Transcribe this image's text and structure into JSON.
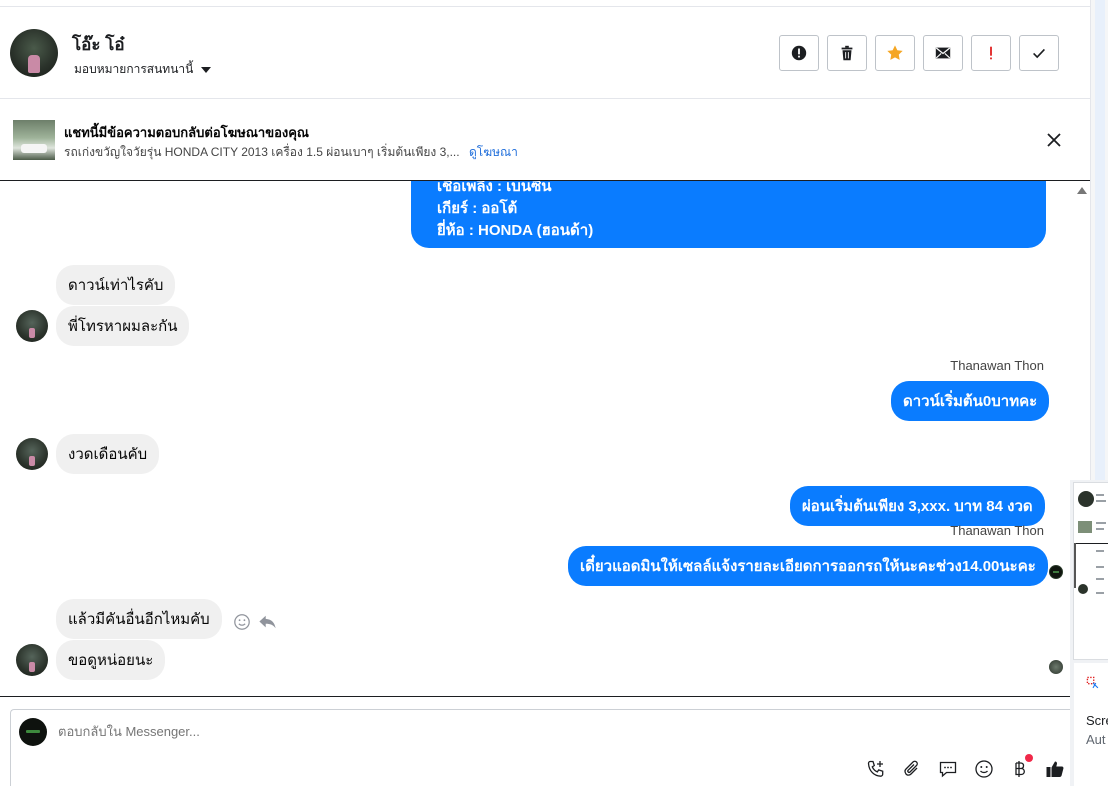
{
  "header": {
    "contact_name": "โอ๊ะ โอ๋",
    "assign_label": "มอบหมายการสนทนานี้",
    "buttons": [
      {
        "name": "mark-spam-button",
        "icon": "exclamation-circle-icon"
      },
      {
        "name": "delete-button",
        "icon": "trash-icon"
      },
      {
        "name": "star-button",
        "icon": "star-icon",
        "color": "#f5a623"
      },
      {
        "name": "mark-unread-button",
        "icon": "envelope-icon"
      },
      {
        "name": "follow-up-button",
        "icon": "exclamation-icon",
        "color": "#e02020"
      },
      {
        "name": "mark-done-button",
        "icon": "checkmark-icon"
      }
    ]
  },
  "ad_banner": {
    "title": "แชทนี้มีข้อความตอบกลับต่อโฆษณาของคุณ",
    "subtitle": "รถเก่งขวัญใจวัยรุ่น HONDA CITY 2013 เครื่อง 1.5 ผ่อนเบาๆ เริ่มต้นเพียง 3,...",
    "link": "ดูโฆษณา"
  },
  "messages": {
    "m1_lines": [
      "เชื้อเพลิง : เบนซิน",
      "เกียร์ : ออโต้",
      "ยี่ห้อ : HONDA (ฮอนด้า)"
    ],
    "m2": "ดาวน์เท่าไรคับ",
    "m3": "พี่โทรหาผมละกัน",
    "sender1": "Thanawan Thon",
    "m4": "ดาวน์เริ่มต้น0บาทคะ",
    "m5": "งวดเดือนคับ",
    "m6": "ผ่อนเริ่มต้นเพียง 3,xxx. บาท 84 งวด",
    "sender2": "Thanawan Thon",
    "m7": "เดี๋ยวแอดมินให้เซลล์แจ้งรายละเอียดการออกรถให้นะคะช่วง14.00นะคะ",
    "m8": "แล้วมีคันอื่นอีกไหมคับ",
    "m9": "ขอดูหน่อยนะ"
  },
  "composer": {
    "placeholder": "ตอบกลับใน Messenger..."
  },
  "side_panel": {
    "text1": "Scre",
    "text2": "Aut"
  },
  "colors": {
    "outgoing_bubble": "#0a7cff",
    "incoming_bubble": "#f0f0f0",
    "link": "#216fdb"
  }
}
